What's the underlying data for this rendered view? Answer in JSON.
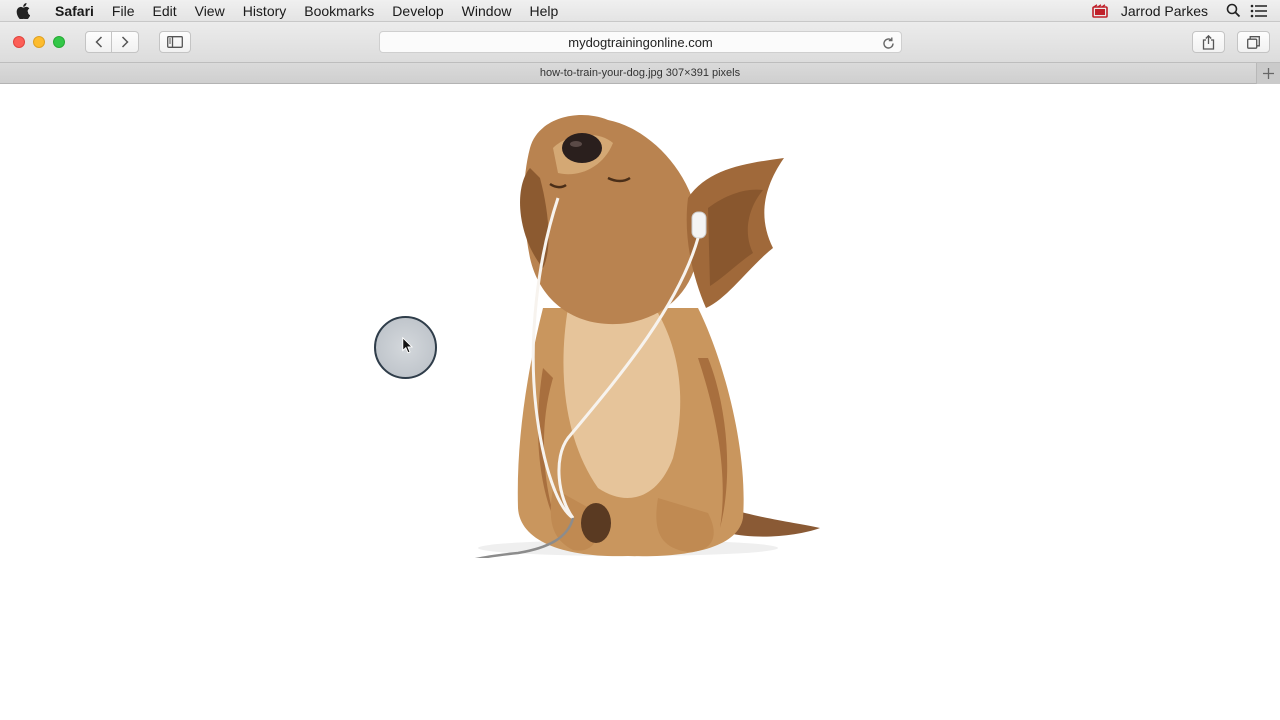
{
  "menubar": {
    "app_name": "Safari",
    "items": [
      "File",
      "Edit",
      "View",
      "History",
      "Bookmarks",
      "Develop",
      "Window",
      "Help"
    ],
    "user_name": "Jarrod Parkes",
    "icons": [
      "apple-icon",
      "screen-record-icon",
      "spotlight-search-icon",
      "notification-center-icon"
    ]
  },
  "toolbar": {
    "address": "mydogtrainingonline.com",
    "icons": [
      "back-icon",
      "forward-icon",
      "sidebar-icon",
      "reload-icon",
      "share-icon",
      "show-all-tabs-icon"
    ]
  },
  "tab": {
    "title": "how-to-train-your-dog.jpg 307×391 pixels"
  },
  "colors": {
    "close": "#fc5f57",
    "minimize": "#fdbc2e",
    "zoom": "#33c748",
    "record": "#c0202a"
  }
}
